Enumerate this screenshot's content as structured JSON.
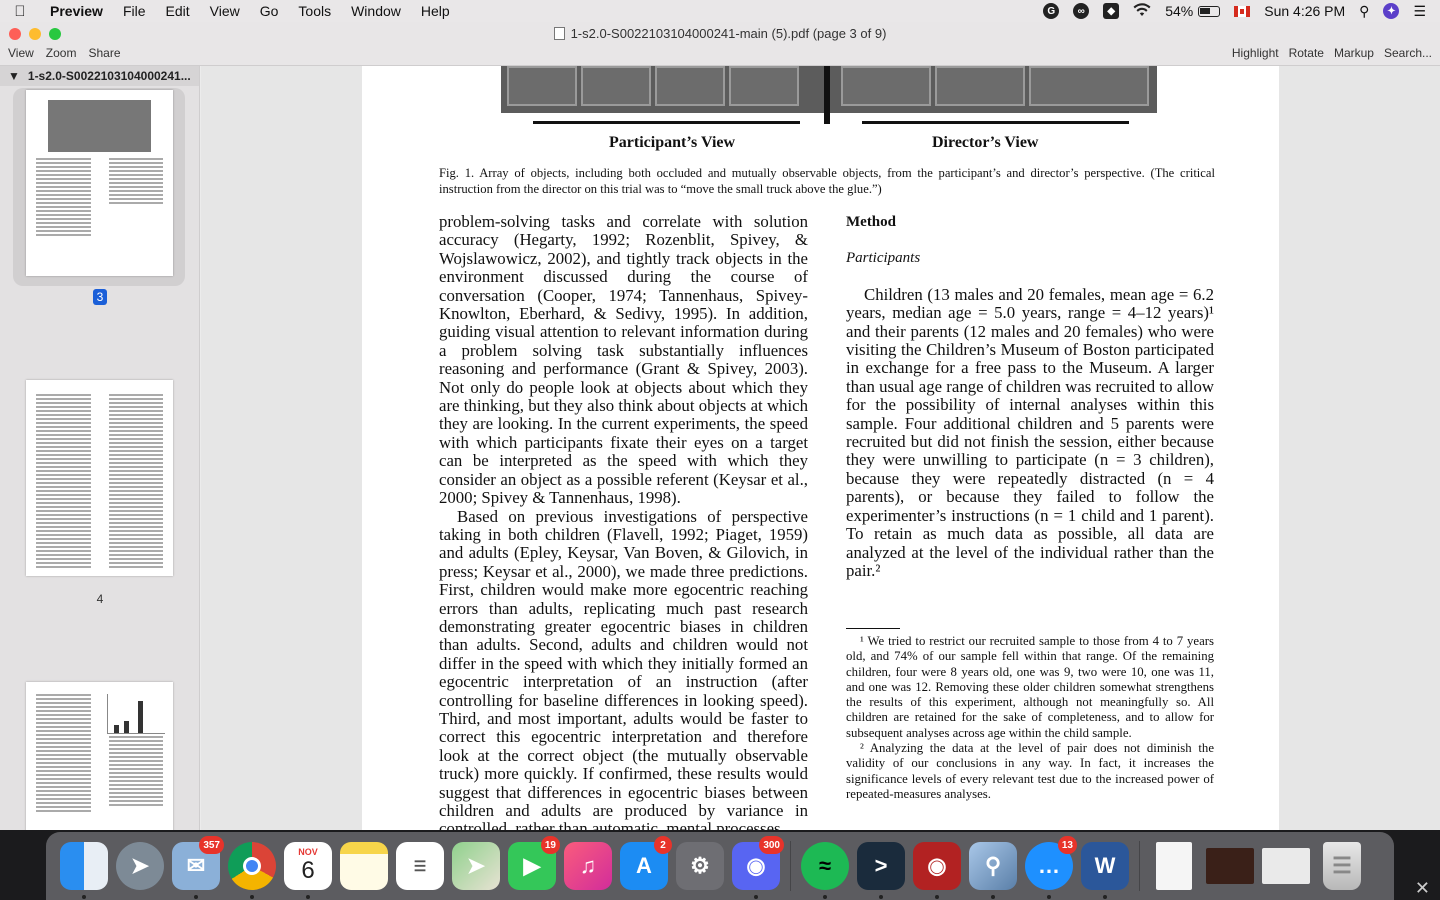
{
  "menubar": {
    "app_name": "Preview",
    "items": [
      "File",
      "Edit",
      "View",
      "Go",
      "Tools",
      "Window",
      "Help"
    ],
    "battery": "54%",
    "clock": "Sun 4:26 PM"
  },
  "window": {
    "title": "1-s2.0-S0022103104000241-main (5).pdf (page 3 of 9)",
    "toolbar_left": [
      "View",
      "Zoom",
      "Share"
    ],
    "toolbar_right": [
      "Highlight",
      "Rotate",
      "Markup",
      "Search..."
    ]
  },
  "sidebar": {
    "file_label": "1-s2.0-S0022103104000241...",
    "pages": [
      {
        "number": "3",
        "selected": true
      },
      {
        "number": "4",
        "selected": false
      }
    ]
  },
  "document": {
    "figure_labels": {
      "left": "Participant’s View",
      "right": "Director’s View"
    },
    "caption": "Fig. 1. Array of objects, including both occluded and mutually observable objects, from the participant’s and director’s perspective. (The critical instruction from the director on this trial was to “move the small truck above the glue.”)",
    "left_col_p1": "problem-solving tasks and correlate with solution accuracy (Hegarty, 1992; Rozenblit, Spivey, & Wojslawowicz, 2002), and tightly track objects in the environment discussed during the course of conversation (Cooper, 1974; Tannenhaus, Spivey-Knowlton, Eberhard, & Sedivy, 1995). In addition, guiding visual attention to relevant information during a problem solving task substantially influences reasoning and performance (Grant & Spivey, 2003). Not only do people look at objects about which they are thinking, but they also think about objects at which they are looking. In the current experiments, the speed with which participants fixate their eyes on a target can be interpreted as the speed with which they consider an object as a possible referent (Keysar et al., 2000; Spivey & Tannenhaus, 1998).",
    "left_col_p2": "Based on previous investigations of perspective taking in both children (Flavell, 1992; Piaget, 1959) and adults (Epley, Keysar, Van Boven, & Gilovich, in press; Keysar et al., 2000), we made three predictions. First, children would make more egocentric reaching errors than adults, replicating much past research demonstrating greater egocentric biases in children than adults. Second, adults and children would not differ in the speed with which they initially formed an egocentric interpretation of an instruction (after controlling for baseline differences in looking speed). Third, and most important, adults would be faster to correct this egocentric interpretation and therefore look at the correct object (the mutually observable truck) more quickly. If confirmed, these results would suggest that differences in egocentric biases between children and adults are produced by variance in controlled, rather than automatic, mental processes.",
    "method_heading": "Method",
    "participants_heading": "Participants",
    "right_col_p1": "Children (13 males and 20 females, mean age = 6.2 years, median age = 5.0 years, range = 4–12 years)¹ and their parents (12 males and 20 females) who were visiting the Children’s Museum of Boston participated in exchange for a free pass to the Museum. A larger than usual age range of children was recruited to allow for the possibility of internal analyses within this sample. Four additional children and 5 parents were recruited but did not finish the session, either because they were unwilling to participate (n = 3 children), because they were repeatedly distracted (n = 4 parents), or because they failed to follow the experimenter’s instructions (n = 1 child and 1 parent). To retain as much data as possible, all data are analyzed at the level of the individual rather than the pair.²",
    "footnote1": "¹ We tried to restrict our recruited sample to those from 4 to 7 years old, and 74% of our sample fell within that range. Of the remaining children, four were 8 years old, one was 9, two were 10, one was 11, and one was 12. Removing these older children somewhat strengthens the results of this experiment, although not meaningfully so. All children are retained for the sake of completeness, and to allow for subsequent analyses across age within the child sample.",
    "footnote2": "² Analyzing the data at the level of pair does not diminish the validity of our conclusions in any way. In fact, it increases the significance levels of every relevant test due to the increased power of repeated-measures analyses."
  },
  "dock": {
    "calendar_month": "NOV",
    "calendar_day": "6",
    "badges": {
      "mail": "357",
      "facetime": "19",
      "appstore": "2",
      "discord": "300",
      "messages": "13"
    }
  }
}
